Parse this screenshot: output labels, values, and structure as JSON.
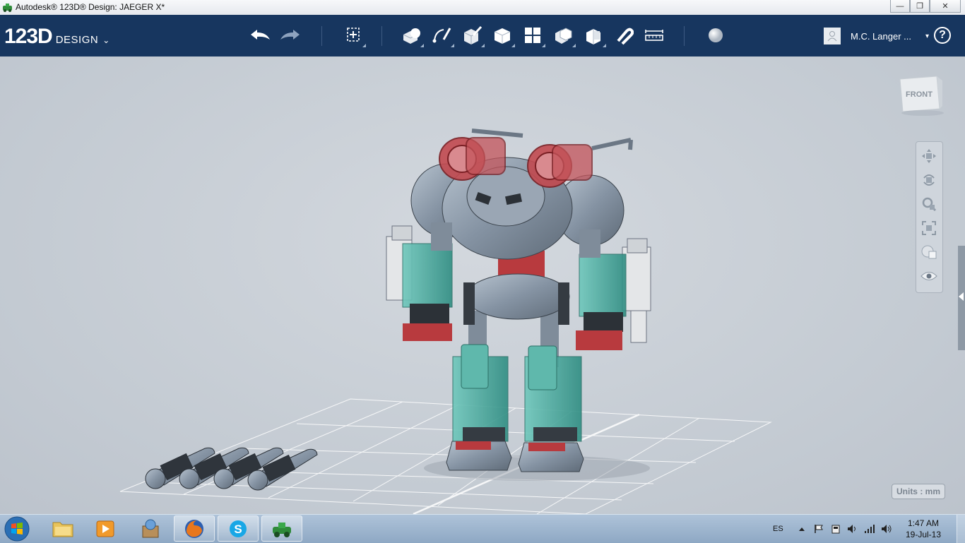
{
  "window": {
    "title": "Autodesk® 123D® Design: JAEGER X*",
    "minimize_glyph": "—",
    "maximize_glyph": "❐",
    "close_glyph": "✕"
  },
  "toolbar": {
    "logo_number": "123D",
    "logo_word": "DESIGN",
    "logo_menu_glyph": "⌄",
    "tools": [
      "undo",
      "redo",
      "transform",
      "primitives",
      "sketch",
      "construct",
      "modify",
      "pattern",
      "grouping",
      "combine",
      "snap",
      "measure",
      "material"
    ],
    "user_name": "M.C. Langer ...",
    "user_caret": "▾",
    "help_label": "?"
  },
  "viewport": {
    "viewcube_face": "FRONT",
    "units_label": "Units : mm",
    "nav_tools": [
      "pan",
      "orbit",
      "zoom",
      "fit",
      "view",
      "visibility"
    ],
    "accent_colors": {
      "teal": "#3aa89a",
      "red": "#b83a3e",
      "gray": "#8e9baa"
    }
  },
  "taskbar": {
    "apps": [
      "start",
      "file-explorer",
      "media-player",
      "archive",
      "firefox",
      "skype",
      "123d-design"
    ],
    "language": "ES",
    "time": "1:47 AM",
    "date": "19-Jul-13"
  }
}
